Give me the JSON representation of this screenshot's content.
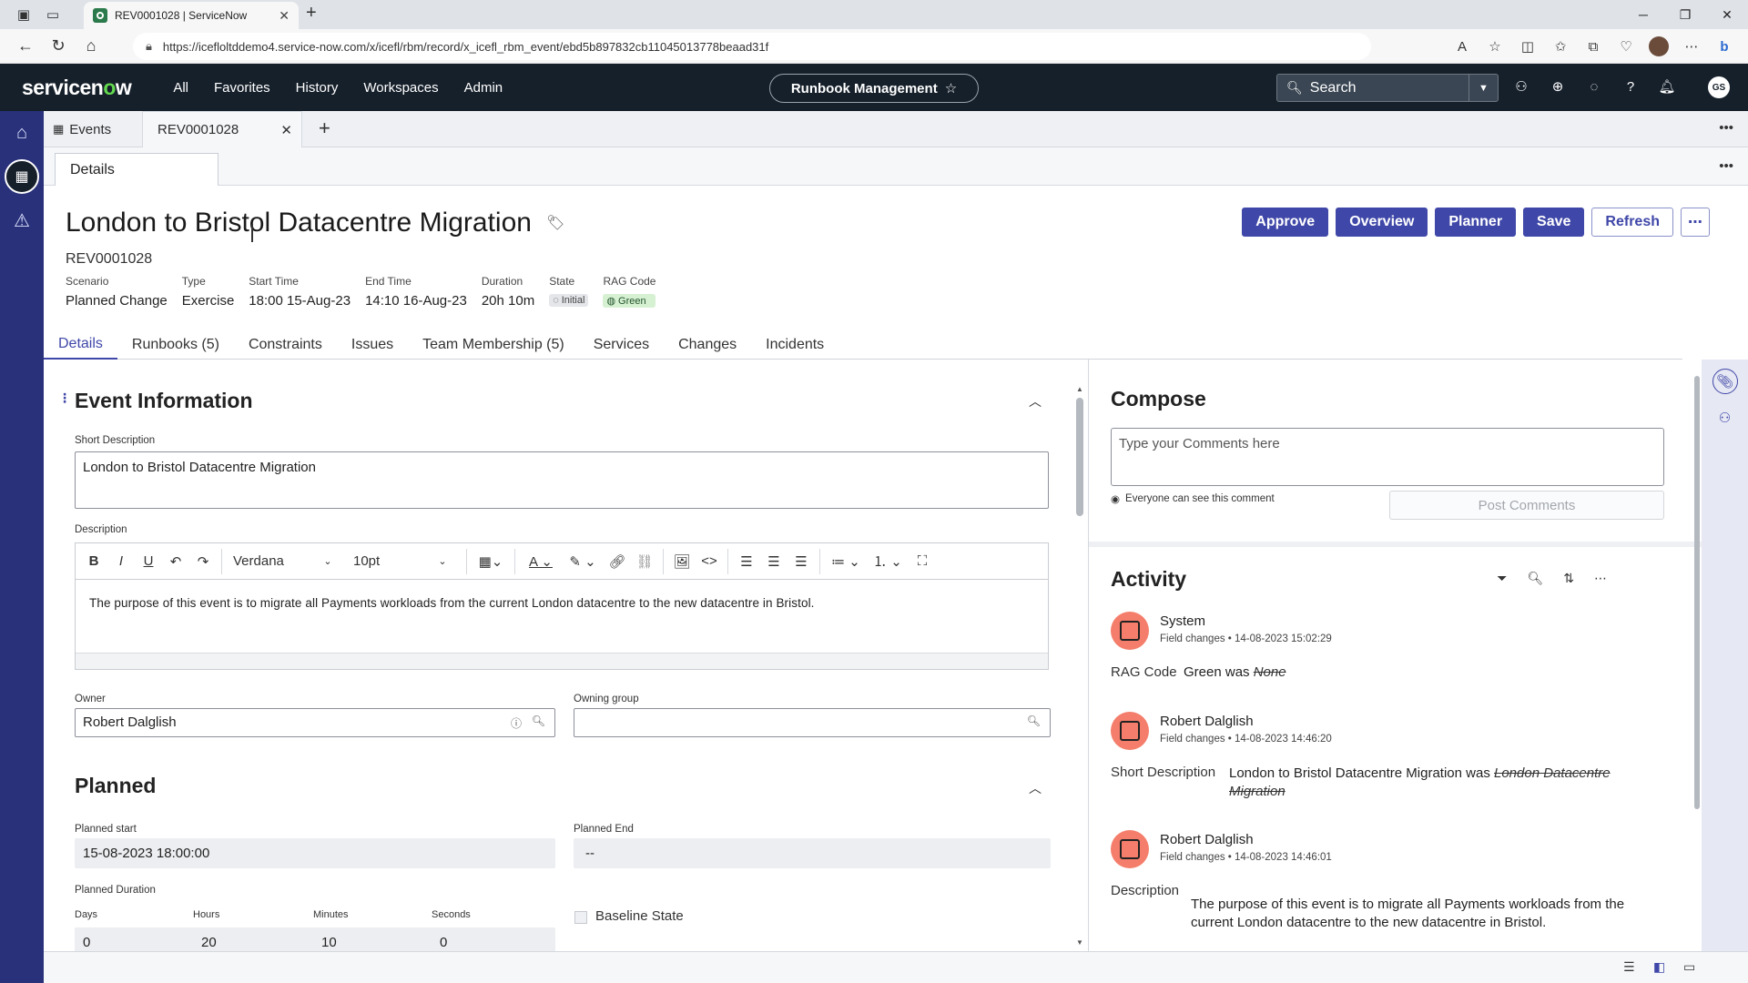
{
  "browser": {
    "tab_title": "REV0001028 | ServiceNow",
    "url": "https://icefloltddemo4.service-now.com/x/icefl/rbm/record/x_icefl_rbm_event/ebd5b897832cb11045013778beaad31f"
  },
  "header": {
    "logo": "servicenow",
    "menu": [
      "All",
      "Favorites",
      "History",
      "Workspaces",
      "Admin"
    ],
    "scope": "Runbook Management",
    "search_placeholder": "Search",
    "user_initials": "GS"
  },
  "workspace_tabs": {
    "list_tab": "Events",
    "record_tab": "REV0001028"
  },
  "subtab": "Details",
  "record": {
    "title": "London to Bristol Datacentre Migration",
    "number": "REV0001028",
    "meta": [
      {
        "label": "Scenario",
        "value": "Planned Change"
      },
      {
        "label": "Type",
        "value": "Exercise"
      },
      {
        "label": "Start Time",
        "value": "18:00 15-Aug-23"
      },
      {
        "label": "End Time",
        "value": "14:10 16-Aug-23"
      },
      {
        "label": "Duration",
        "value": "20h 10m"
      },
      {
        "label": "State",
        "value": "Initial"
      },
      {
        "label": "RAG Code",
        "value": "Green"
      }
    ]
  },
  "actions": {
    "approve": "Approve",
    "overview": "Overview",
    "planner": "Planner",
    "save": "Save",
    "refresh": "Refresh"
  },
  "record_tabs": [
    "Details",
    "Runbooks (5)",
    "Constraints",
    "Issues",
    "Team Membership (5)",
    "Services",
    "Changes",
    "Incidents"
  ],
  "event_info": {
    "section_title": "Event Information",
    "short_desc_label": "Short Description",
    "short_desc_value": "London to Bristol Datacentre Migration",
    "desc_label": "Description",
    "font_family": "Verdana",
    "font_size": "10pt",
    "desc_value": "The purpose of this event is to migrate all Payments workloads from the current London datacentre to the new datacentre in Bristol.",
    "owner_label": "Owner",
    "owner_value": "Robert Dalglish",
    "owning_group_label": "Owning group",
    "owning_group_value": ""
  },
  "planned": {
    "section_title": "Planned",
    "start_label": "Planned start",
    "start_value": "15-08-2023 18:00:00",
    "end_label": "Planned End",
    "end_value": "--",
    "duration_label": "Planned Duration",
    "days_label": "Days",
    "days_value": "0",
    "hours_label": "Hours",
    "hours_value": "20",
    "minutes_label": "Minutes",
    "minutes_value": "10",
    "seconds_label": "Seconds",
    "seconds_value": "0",
    "baseline_label": "Baseline State"
  },
  "compose": {
    "title": "Compose",
    "placeholder": "Type your Comments here",
    "visibility": "Everyone can see this comment",
    "post_label": "Post Comments"
  },
  "activity": {
    "title": "Activity",
    "items": [
      {
        "who": "System",
        "meta": "Field changes • 14-08-2023 15:02:29",
        "field": "RAG Code",
        "new": "Green",
        "was": " was ",
        "old": "None"
      },
      {
        "who": "Robert Dalglish",
        "meta": "Field changes • 14-08-2023 14:46:20",
        "field": "Short Description",
        "new": "London to Bristol Datacentre Migration",
        "was": " was ",
        "old": "London Datacentre Migration"
      },
      {
        "who": "Robert Dalglish",
        "meta": "Field changes • 14-08-2023 14:46:01",
        "field": "Description",
        "new": "The purpose of this event is to migrate all Payments workloads from the current London datacentre to the new datacentre in Bristol."
      }
    ]
  }
}
